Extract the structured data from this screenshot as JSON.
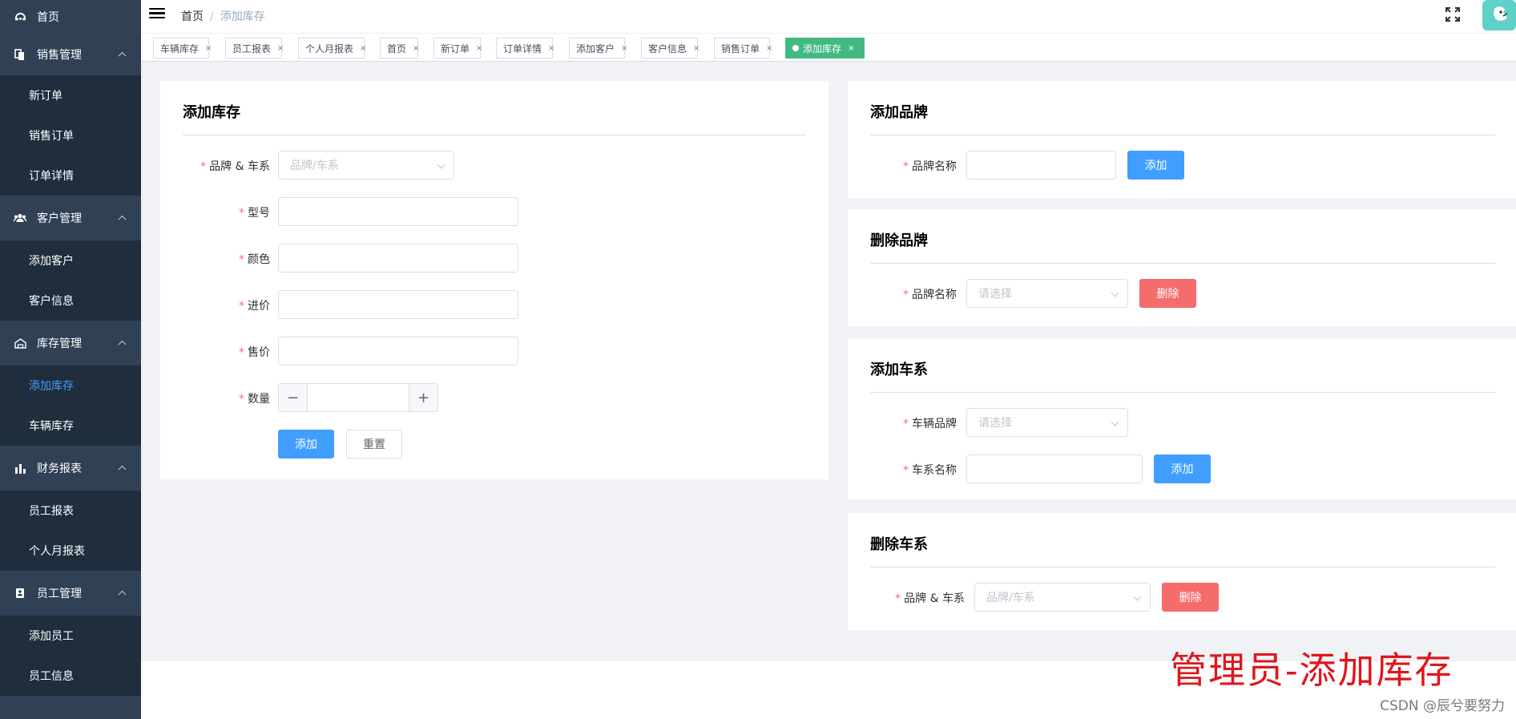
{
  "sidebar": {
    "home": "首页",
    "sales": {
      "title": "销售管理",
      "items": [
        "新订单",
        "销售订单",
        "订单详情"
      ]
    },
    "customers": {
      "title": "客户管理",
      "items": [
        "添加客户",
        "客户信息"
      ]
    },
    "inventory": {
      "title": "库存管理",
      "items": [
        "添加库存",
        "车辆库存"
      ]
    },
    "finance": {
      "title": "财务报表",
      "items": [
        "员工报表",
        "个人月报表"
      ]
    },
    "staff": {
      "title": "员工管理",
      "items": [
        "添加员工",
        "员工信息"
      ]
    }
  },
  "navbar": {
    "breadcrumb_home": "首页",
    "breadcrumb_sep": "/",
    "breadcrumb_current": "添加库存"
  },
  "tags": [
    {
      "label": "车辆库存",
      "close": "×"
    },
    {
      "label": "员工报表",
      "close": "×"
    },
    {
      "label": "个人月报表",
      "close": "×"
    },
    {
      "label": "首页",
      "close": "×"
    },
    {
      "label": "新订单",
      "close": "×"
    },
    {
      "label": "订单详情",
      "close": "×"
    },
    {
      "label": "添加客户",
      "close": "×"
    },
    {
      "label": "客户信息",
      "close": "×"
    },
    {
      "label": "销售订单",
      "close": "×"
    },
    {
      "label": "添加库存",
      "close": "×",
      "active": true
    }
  ],
  "add_stock": {
    "title": "添加库存",
    "brand_series_label": "品牌 & 车系",
    "brand_series_placeholder": "品牌/车系",
    "model_label": "型号",
    "color_label": "颜色",
    "purchase_price_label": "进价",
    "sale_price_label": "售价",
    "quantity_label": "数量",
    "quantity_dec": "−",
    "quantity_inc": "+",
    "add_button": "添加",
    "reset_button": "重置"
  },
  "add_brand": {
    "title": "添加品牌",
    "name_label": "品牌名称",
    "add_button": "添加"
  },
  "delete_brand": {
    "title": "删除品牌",
    "name_label": "品牌名称",
    "placeholder": "请选择",
    "delete_button": "删除"
  },
  "add_series": {
    "title": "添加车系",
    "brand_label": "车辆品牌",
    "brand_placeholder": "请选择",
    "name_label": "车系名称",
    "add_button": "添加"
  },
  "delete_series": {
    "title": "删除车系",
    "label": "品牌 & 车系",
    "placeholder": "品牌/车系",
    "delete_button": "删除"
  },
  "required_mark": "*",
  "watermark": "管理员-添加库存",
  "csdn_credit": "CSDN @辰兮要努力",
  "colors": {
    "sidebar_bg": "#304156",
    "submenu_bg": "#1f2d3d",
    "primary": "#409eff",
    "danger": "#f56c6c",
    "active_tag": "#42b983",
    "watermark": "#e0161d"
  }
}
